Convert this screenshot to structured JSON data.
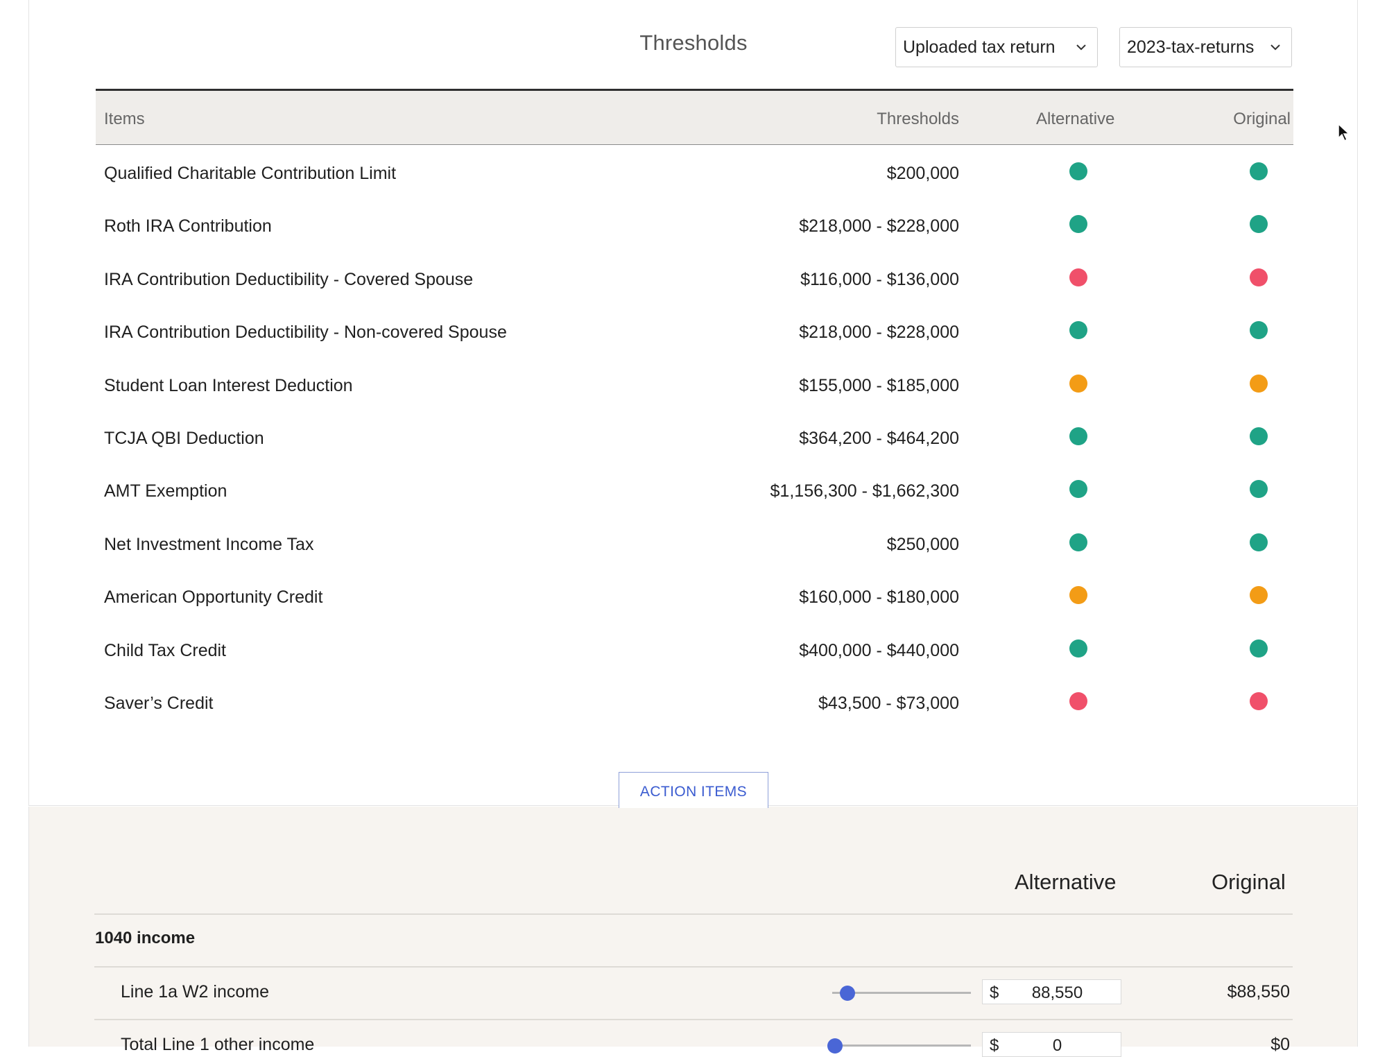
{
  "header": {
    "title": "Thresholds",
    "source_select": "Uploaded tax return",
    "year_select": "2023-tax-returns"
  },
  "table": {
    "columns": [
      "Items",
      "Thresholds",
      "Alternative",
      "Original"
    ],
    "rows": [
      {
        "item": "Qualified Charitable Contribution Limit",
        "threshold": "$200,000",
        "alternative": "green",
        "original": "green"
      },
      {
        "item": "Roth IRA Contribution",
        "threshold": "$218,000 - $228,000",
        "alternative": "green",
        "original": "green"
      },
      {
        "item": "IRA Contribution Deductibility - Covered Spouse",
        "threshold": "$116,000 - $136,000",
        "alternative": "red",
        "original": "red"
      },
      {
        "item": "IRA Contribution Deductibility - Non-covered Spouse",
        "threshold": "$218,000 - $228,000",
        "alternative": "green",
        "original": "green"
      },
      {
        "item": "Student Loan Interest Deduction",
        "threshold": "$155,000 - $185,000",
        "alternative": "orange",
        "original": "orange"
      },
      {
        "item": "TCJA QBI Deduction",
        "threshold": "$364,200 - $464,200",
        "alternative": "green",
        "original": "green"
      },
      {
        "item": "AMT Exemption",
        "threshold": "$1,156,300 - $1,662,300",
        "alternative": "green",
        "original": "green"
      },
      {
        "item": "Net Investment Income Tax",
        "threshold": "$250,000",
        "alternative": "green",
        "original": "green"
      },
      {
        "item": "American Opportunity Credit",
        "threshold": "$160,000 - $180,000",
        "alternative": "orange",
        "original": "orange"
      },
      {
        "item": "Child Tax Credit",
        "threshold": "$400,000 - $440,000",
        "alternative": "green",
        "original": "green"
      },
      {
        "item": "Saver’s Credit",
        "threshold": "$43,500 - $73,000",
        "alternative": "red",
        "original": "red"
      }
    ]
  },
  "status_colors": {
    "green": "#1fa386",
    "red": "#f0506a",
    "orange": "#f39c16"
  },
  "action_button": "ACTION ITEMS",
  "comparison": {
    "alt_header": "Alternative",
    "orig_header": "Original",
    "section": "1040 income",
    "lines": [
      {
        "label": "Line 1a W2 income",
        "currency": "$",
        "alt_value": "88,550",
        "original": "$88,550",
        "slider_fraction": 0.11
      },
      {
        "label": "Total Line 1 other income",
        "currency": "$",
        "alt_value": "0",
        "original": "$0",
        "slider_fraction": 0.02
      }
    ]
  }
}
